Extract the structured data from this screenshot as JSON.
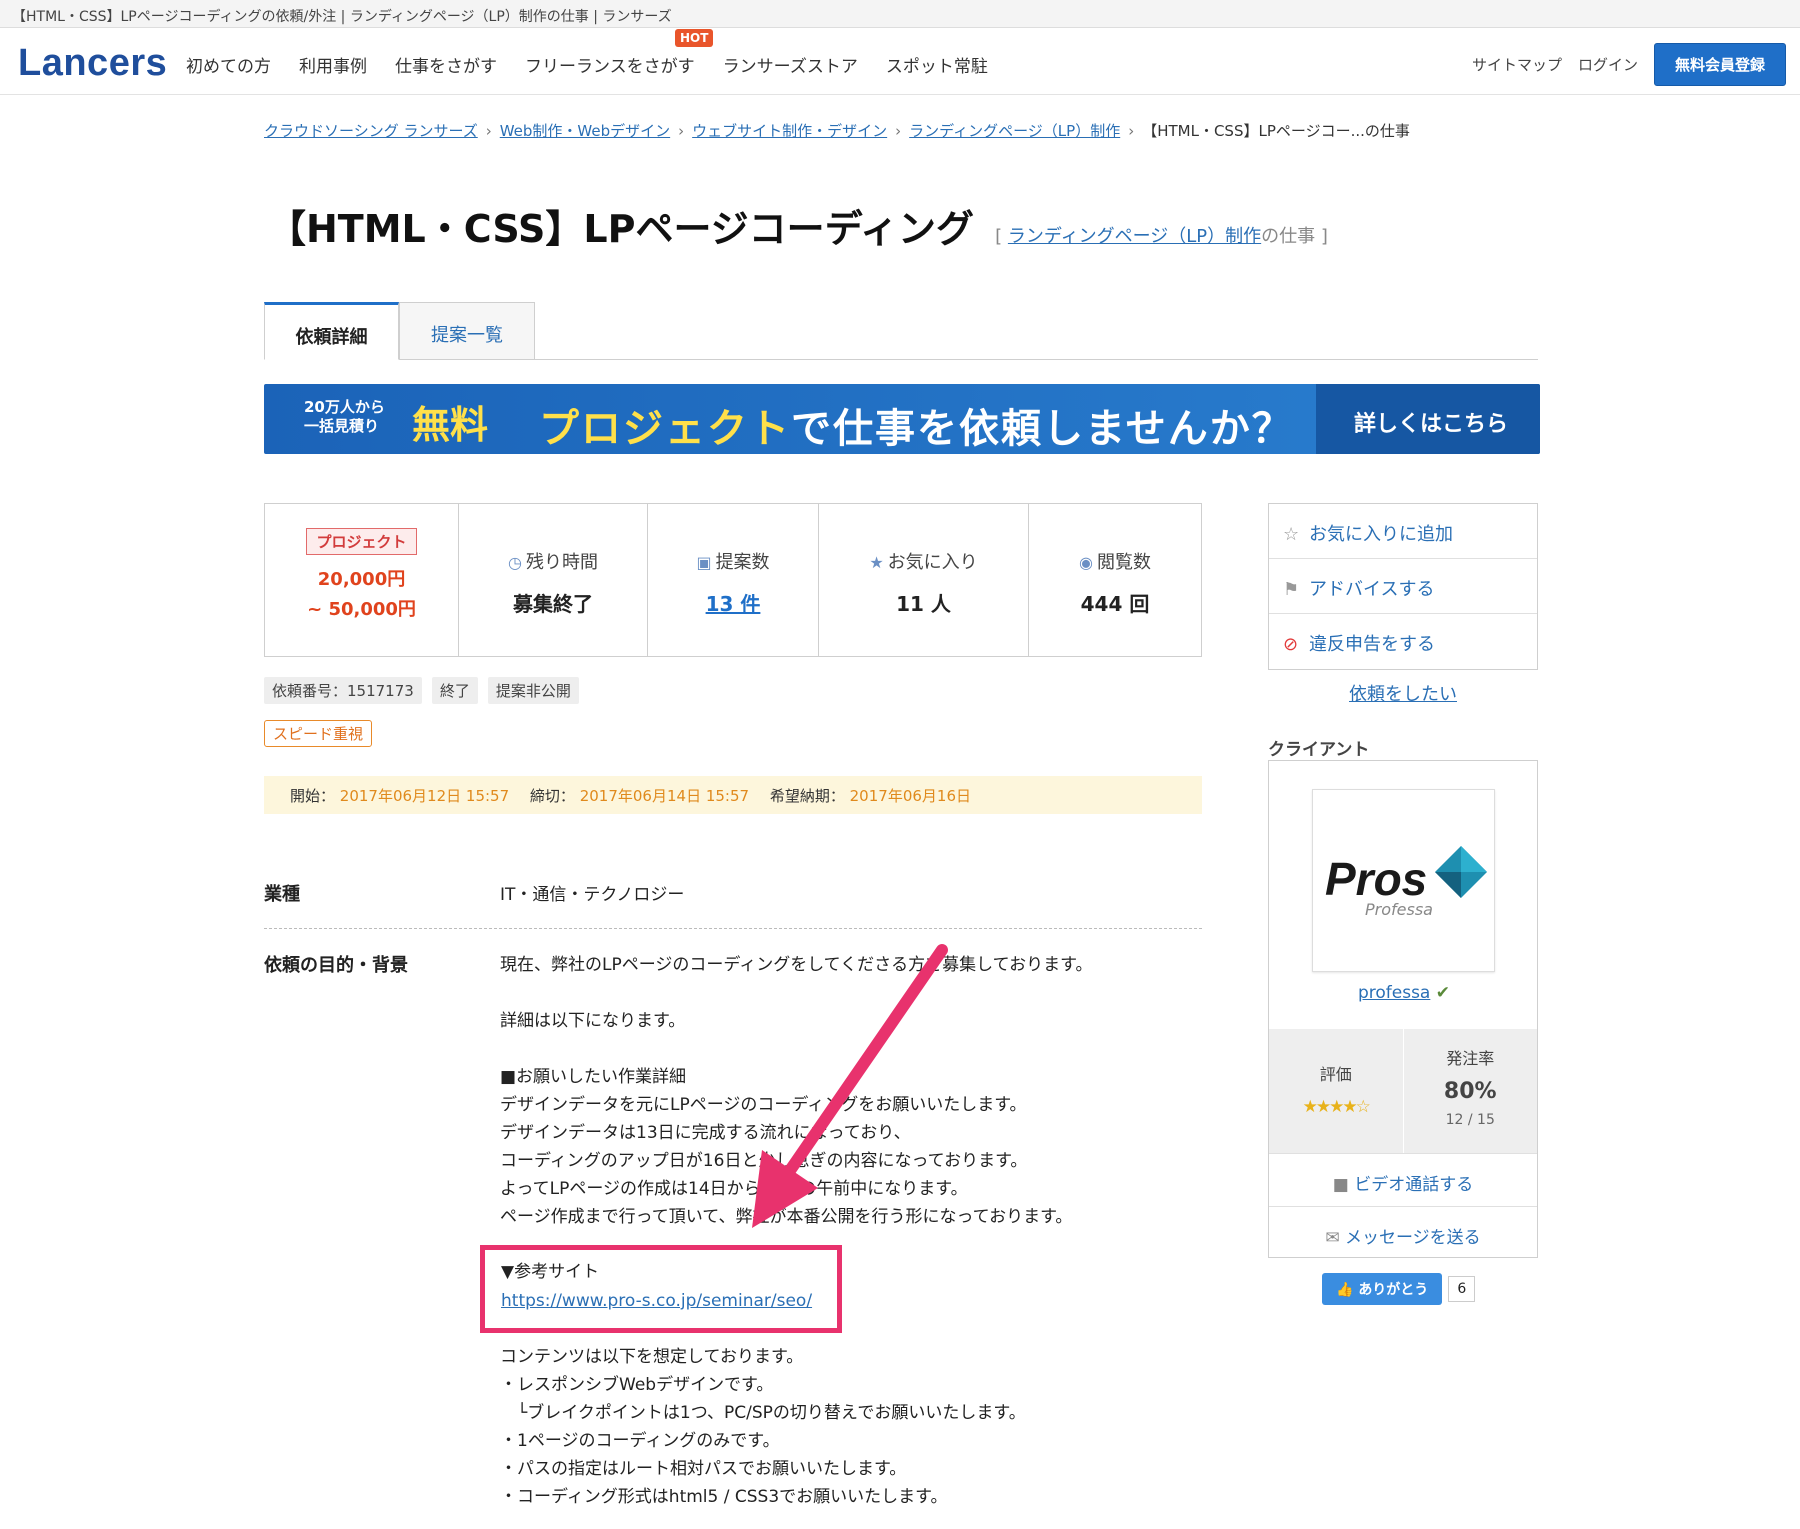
{
  "window": {
    "title": "【HTML・CSS】LPページコーディングの依頼/外注 | ランディングページ（LP）制作の仕事 | ランサーズ"
  },
  "header": {
    "logo": "Lancers",
    "nav": [
      "初めての方",
      "利用事例",
      "仕事をさがす",
      "フリーランスをさがす",
      "ランサーズストア",
      "スポット常駐"
    ],
    "hot_badge": "HOT",
    "sitemap": "サイトマップ",
    "login": "ログイン",
    "signup": "無料会員登録"
  },
  "breadcrumb": {
    "items": [
      "クラウドソーシング ランサーズ",
      "Web制作・Webデザイン",
      "ウェブサイト制作・デザイン",
      "ランディングページ（LP）制作"
    ],
    "current": "【HTML・CSS】LPページコー...の仕事",
    "separator": "›"
  },
  "page": {
    "title": "【HTML・CSS】LPページコーディング",
    "category_open": "[",
    "category_link": "ランディングページ（LP）制作",
    "category_suffix": "の仕事",
    "category_close": "]"
  },
  "tabs": {
    "detail": "依頼詳細",
    "proposals": "提案一覧"
  },
  "banner": {
    "left_line1": "20万人から",
    "left_line2": "一括見積り",
    "free": "無料",
    "main_highlight": "プロジェクト",
    "main_rest": "で仕事を依頼しませんか？",
    "cta": "詳しくはこちら"
  },
  "stats": {
    "project_badge": "プロジェクト",
    "price_min": "20,000円",
    "price_max": "~ 50,000円",
    "remaining_label": "残り時間",
    "remaining_value": "募集終了",
    "proposals_label": "提案数",
    "proposals_value": "13 件",
    "favorites_label": "お気に入り",
    "favorites_value": "11 人",
    "views_label": "閲覧数",
    "views_value": "444 回"
  },
  "tags": [
    "依頼番号：1517173",
    "終了",
    "提案非公開"
  ],
  "speed_tag": "スピード重視",
  "dates": {
    "start_label": "開始：",
    "start": "2017年06月12日 15:57",
    "deadline_label": "締切：",
    "deadline": "2017年06月14日 15:57",
    "delivery_label": "希望納期：",
    "delivery": "2017年06月16日"
  },
  "detail": {
    "industry_label": "業種",
    "industry": "IT・通信・テクノロジー",
    "purpose_label": "依頼の目的・背景",
    "lines_a": [
      "現在、弊社のLPページのコーディングをしてくださる方を募集しております。"
    ],
    "lines_b": [
      "詳細は以下になります。"
    ],
    "lines_c": [
      "■お願いしたい作業詳細",
      "デザインデータを元にLPページのコーディングをお願いいたします。",
      "デザインデータは13日に完成する流れになっており、",
      "コーディングのアップ日が16日と少し急ぎの内容になっております。",
      "よってLPページの作成は14日から15日の午前中になります。",
      "ページ作成まで行って頂いて、弊社が本番公開を行う形になっております。"
    ],
    "ref_label": "▼参考サイト",
    "ref_url": "https://www.pro-s.co.jp/seminar/seo/",
    "lines_d": [
      "コンテンツは以下を想定しております。",
      "・レスポンシブWebデザインです。",
      "　└ブレイクポイントは1つ、PC/SPの切り替えでお願いいたします。",
      "・1ページのコーディングのみです。",
      "・パスの指定はルート相対パスでお願いいたします。",
      "・コーディング形式はhtml5 / CSS3でお願いいたします。"
    ]
  },
  "side": {
    "favorite": "お気に入りに追加",
    "advice": "アドバイスする",
    "report": "違反申告をする",
    "request": "依頼をしたい"
  },
  "client": {
    "heading": "クライアント",
    "logo_word": "Pros",
    "logo_sub": "Professa",
    "username": "professa",
    "rating_label": "評価",
    "stars": "★★★★☆",
    "order_rate_label": "発注率",
    "order_rate": "80%",
    "order_ratio": "12 / 15",
    "video": "ビデオ通話する",
    "message": "メッセージを送る",
    "thanks": "ありがとう",
    "thanks_count": "6"
  },
  "colors": {
    "brand": "#1f4e9c",
    "link": "#2a6fb5",
    "price": "#e0431d",
    "highlight": "#e8326d",
    "date": "#e08a1d"
  }
}
